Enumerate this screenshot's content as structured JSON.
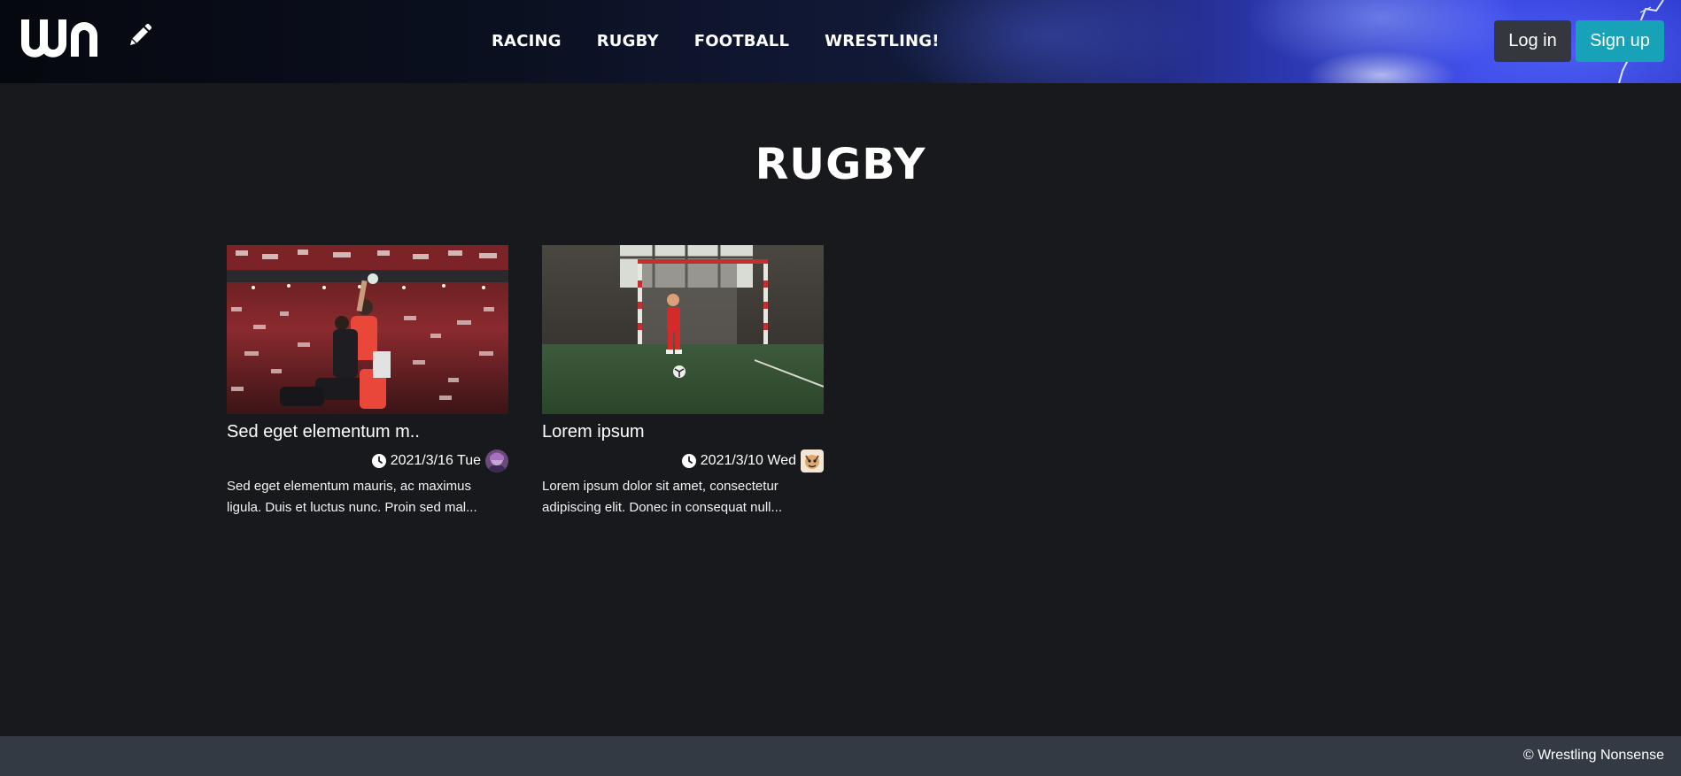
{
  "header": {
    "logo_text": "wn",
    "edit_icon": "pencil-icon",
    "nav": [
      {
        "label": "RACING"
      },
      {
        "label": "RUGBY"
      },
      {
        "label": "FOOTBALL"
      },
      {
        "label": "WRESTLING!"
      }
    ],
    "login_label": "Log in",
    "signup_label": "Sign up"
  },
  "main": {
    "page_title": "RUGBY",
    "articles": [
      {
        "title": "Sed eget elementum m..",
        "date": "2021/3/16 Tue",
        "excerpt_line1": "Sed eget elementum mauris, ac maximus",
        "excerpt_line2": "ligula. Duis et luctus nunc. Proin sed mal..."
      },
      {
        "title": "Lorem ipsum",
        "date": "2021/3/10 Wed",
        "excerpt_line1": "Lorem ipsum dolor sit amet, consectetur",
        "excerpt_line2": "adipiscing elit. Donec in consequat null..."
      }
    ]
  },
  "footer": {
    "copyright": "© Wrestling Nonsense"
  },
  "colors": {
    "background": "#18191c",
    "footer": "#343a44",
    "login": "#34373d",
    "signup": "#17a2b8"
  }
}
